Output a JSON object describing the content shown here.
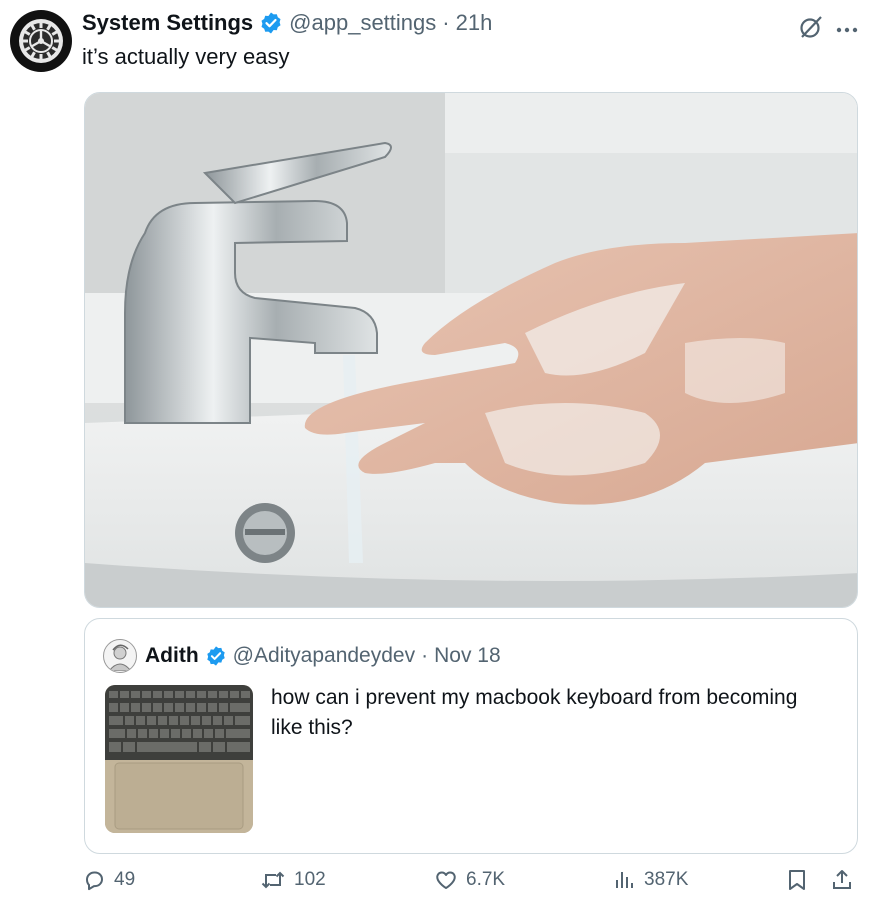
{
  "post": {
    "author_name": "System Settings",
    "handle": "@app_settings",
    "separator": "·",
    "time": "21h",
    "text": "it’s actually very easy"
  },
  "quoted": {
    "author_name": "Adith",
    "handle": "@Adityapandeydev",
    "separator": "·",
    "date": "Nov 18",
    "text": "how can i prevent my macbook keyboard from becoming like this?"
  },
  "actions": {
    "replies": "49",
    "reposts": "102",
    "likes": "6.7K",
    "views": "387K"
  },
  "icons": {
    "avatar": "gear-icon",
    "verified": "verified-badge-icon",
    "grok": "grok-icon",
    "more": "more-icon",
    "reply": "reply-icon",
    "repost": "repost-icon",
    "like": "heart-icon",
    "views": "views-icon",
    "bookmark": "bookmark-icon",
    "share": "share-icon"
  },
  "colors": {
    "verified": "#1d9bf0",
    "secondary_text": "#536471",
    "border": "#cfd9de"
  }
}
